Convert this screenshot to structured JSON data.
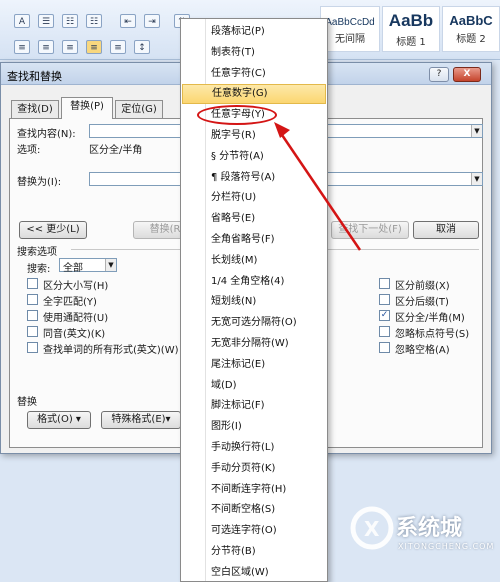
{
  "ribbon": {
    "font_button": "A",
    "styles": [
      {
        "preview": "AaBbCcDd",
        "name": "无间隔"
      },
      {
        "preview": "AaBb",
        "name": "标题 1"
      },
      {
        "preview": "AaBbC",
        "name": "标题 2"
      }
    ]
  },
  "dialog": {
    "title": "查找和替换",
    "help": "?",
    "close": "X",
    "tabs": [
      "查找(D)",
      "替换(P)",
      "定位(G)"
    ],
    "find_label": "查找内容(N):",
    "options_label": "选项:",
    "options_value": "区分全/半角",
    "replace_label": "替换为(I):",
    "less_button": "<< 更少(L)",
    "replace_button": "替换(R)",
    "find_next_button": "查找下一处(F)",
    "cancel_button": "取消",
    "search_options_title": "搜索选项",
    "search_label": "搜索:",
    "search_value": "全部",
    "left_checks": [
      {
        "label": "区分大小写(H)",
        "checked": false
      },
      {
        "label": "全字匹配(Y)",
        "checked": false
      },
      {
        "label": "使用通配符(U)",
        "checked": false
      },
      {
        "label": "同音(英文)(K)",
        "checked": false
      },
      {
        "label": "查找单词的所有形式(英文)(W)",
        "checked": false
      }
    ],
    "right_checks": [
      {
        "label": "区分前缀(X)",
        "checked": false
      },
      {
        "label": "区分后缀(T)",
        "checked": false
      },
      {
        "label": "区分全/半角(M)",
        "checked": true,
        "mark": "✓"
      },
      {
        "label": "忽略标点符号(S)",
        "checked": false
      },
      {
        "label": "忽略空格(A)",
        "checked": false
      }
    ],
    "replace_section_title": "替换",
    "format_button": "格式(O) ▾",
    "special_button": "特殊格式(E)▾"
  },
  "menu": {
    "highlight_index": 3,
    "items": [
      "段落标记(P)",
      "制表符(T)",
      "任意字符(C)",
      "任意数字(G)",
      "任意字母(Y)",
      "脱字号(R)",
      "§ 分节符(A)",
      "¶ 段落符号(A)",
      "分栏符(U)",
      "省略号(E)",
      "全角省略号(F)",
      "长划线(M)",
      "1/4 全角空格(4)",
      "短划线(N)",
      "无宽可选分隔符(O)",
      "无宽非分隔符(W)",
      "尾注标记(E)",
      "域(D)",
      "脚注标记(F)",
      "图形(I)",
      "手动换行符(L)",
      "手动分页符(K)",
      "不间断连字符(H)",
      "不间断空格(S)",
      "可选连字符(O)",
      "分节符(B)",
      "空白区域(W)"
    ]
  },
  "watermark": {
    "brand": "系统城",
    "site": "XITONGCHENG.COM"
  },
  "colors": {
    "annotation_red": "#d41515",
    "menu_highlight": "#fbd671"
  }
}
